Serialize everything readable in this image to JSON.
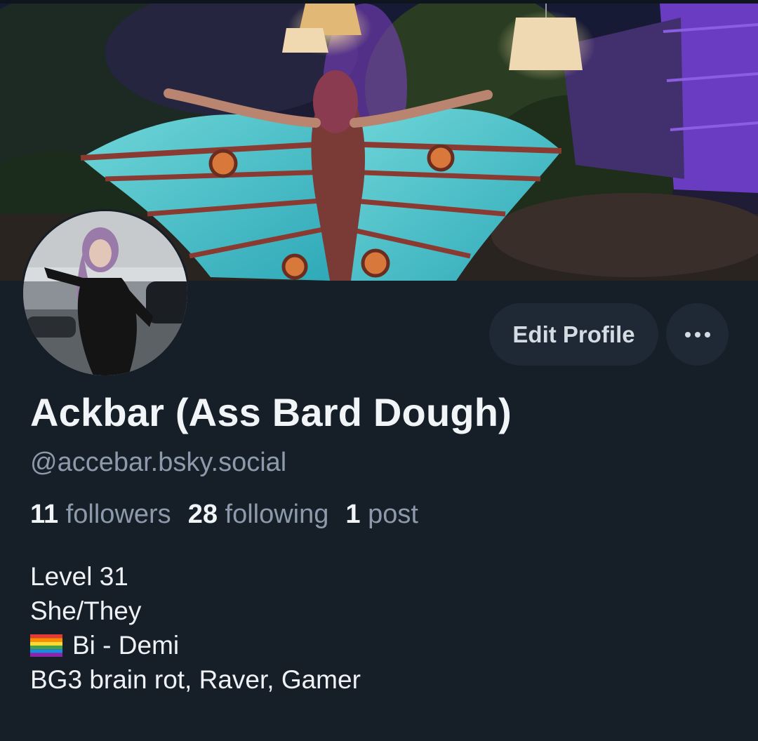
{
  "profile": {
    "display_name": "Ackbar (Ass Bard Dough)",
    "handle": "@accebar.bsky.social"
  },
  "actions": {
    "edit_profile_label": "Edit Profile",
    "more_icon": "ellipsis-icon"
  },
  "stats": {
    "followers_count": "11",
    "followers_label": "followers",
    "following_count": "28",
    "following_label": "following",
    "posts_count": "1",
    "posts_label": "post"
  },
  "bio": {
    "line1": "Level 31",
    "line2": "She/They",
    "line3_flag": "rainbow-flag-icon",
    "line3_text": "Bi - Demi",
    "line4": "BG3 brain rot, Raver, Gamer"
  },
  "colors": {
    "background": "#161e27",
    "button_bg": "#1e2935",
    "muted_text": "#8c9aab",
    "primary_text": "#f2f5f8"
  }
}
